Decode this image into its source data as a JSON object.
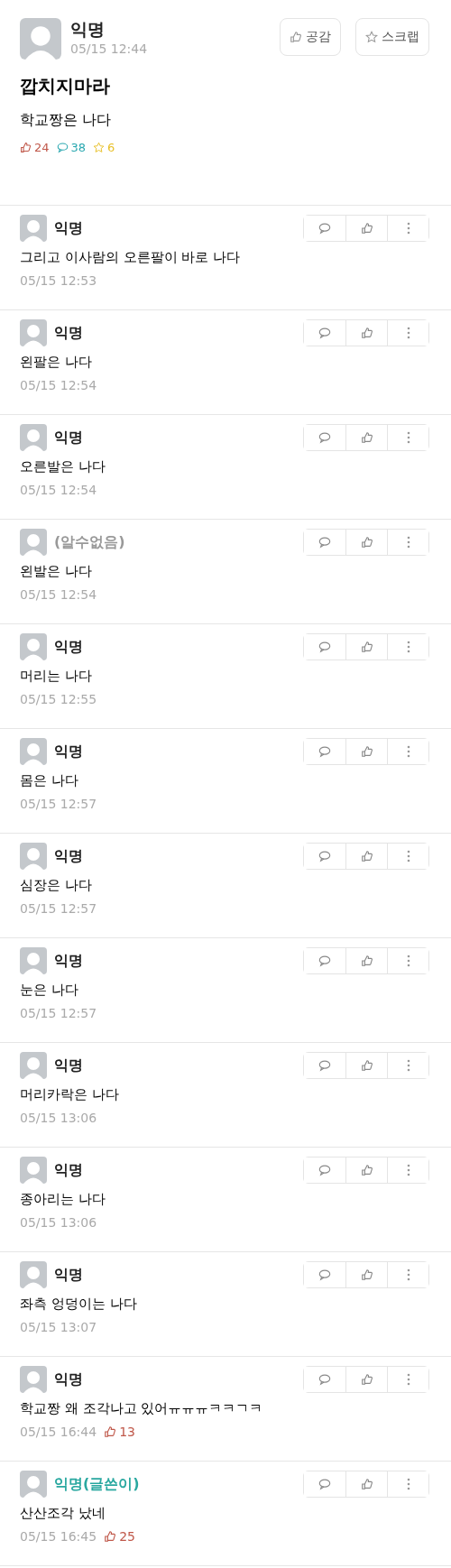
{
  "post": {
    "author": "익명",
    "time": "05/15 12:44",
    "actions": [
      {
        "kind": "like",
        "label": "공감"
      },
      {
        "kind": "scrap",
        "label": "스크랩"
      }
    ],
    "title": "깝치지마라",
    "body": "학교짱은 나다",
    "stats": [
      {
        "kind": "like",
        "value": "24",
        "color": "#c0584a"
      },
      {
        "kind": "comment",
        "value": "38",
        "color": "#2aa8b0"
      },
      {
        "kind": "scrap",
        "value": "6",
        "color": "#e8c02a"
      }
    ]
  },
  "comments": [
    {
      "author": "익명",
      "kind": "anonymous",
      "text": "그리고 이사람의 오른팔이 바로 나다",
      "time": "05/15 12:53"
    },
    {
      "author": "익명",
      "kind": "anonymous",
      "text": "왼팔은 나다",
      "time": "05/15 12:54"
    },
    {
      "author": "익명",
      "kind": "anonymous",
      "text": "오른발은 나다",
      "time": "05/15 12:54"
    },
    {
      "author": "(알수없음)",
      "kind": "unknown",
      "text": "왼발은 나다",
      "time": "05/15 12:54"
    },
    {
      "author": "익명",
      "kind": "anonymous",
      "text": "머리는 나다",
      "time": "05/15 12:55"
    },
    {
      "author": "익명",
      "kind": "anonymous",
      "text": "몸은 나다",
      "time": "05/15 12:57"
    },
    {
      "author": "익명",
      "kind": "anonymous",
      "text": "심장은 나다",
      "time": "05/15 12:57"
    },
    {
      "author": "익명",
      "kind": "anonymous",
      "text": "눈은 나다",
      "time": "05/15 12:57"
    },
    {
      "author": "익명",
      "kind": "anonymous",
      "text": "머리카락은 나다",
      "time": "05/15 13:06"
    },
    {
      "author": "익명",
      "kind": "anonymous",
      "text": "종아리는 나다",
      "time": "05/15 13:06"
    },
    {
      "author": "익명",
      "kind": "anonymous",
      "text": "좌측 엉덩이는 나다",
      "time": "05/15 13:07"
    },
    {
      "author": "익명",
      "kind": "anonymous",
      "text": "학교짱 왜 조각나고 있어ㅠㅠㅠㅋㅋㄱㅋ",
      "time": "05/15 16:44",
      "likes": "13"
    },
    {
      "author": "익명(글쓴이)",
      "kind": "writer",
      "text": "산산조각 났네",
      "time": "05/15 16:45",
      "likes": "25"
    }
  ]
}
